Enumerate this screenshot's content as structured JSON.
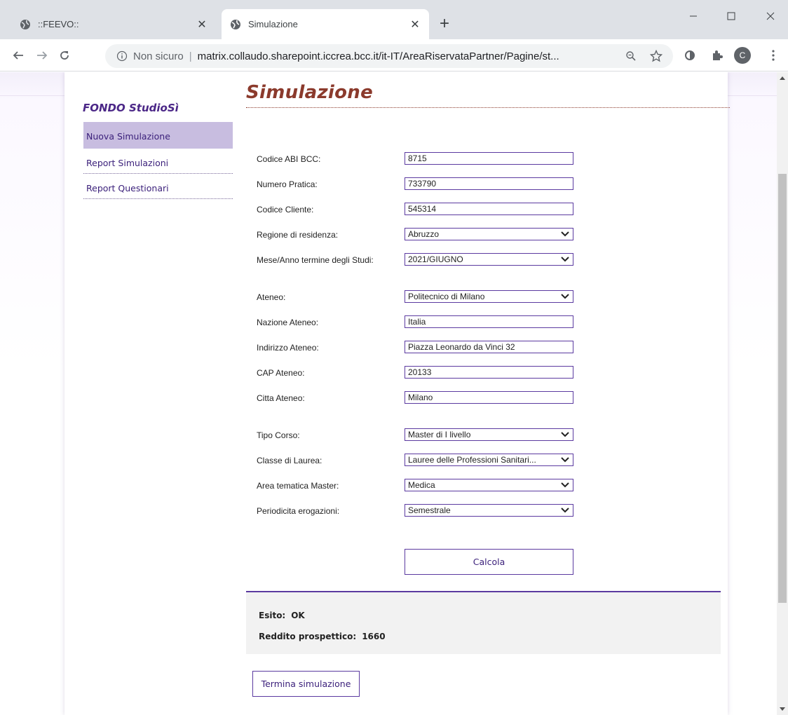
{
  "browser": {
    "tabs": [
      {
        "title": "::FEEVO::",
        "icon": "globe-icon",
        "active": false
      },
      {
        "title": "Simulazione",
        "icon": "globe-icon",
        "active": true
      }
    ],
    "new_tab": "+",
    "window_controls": {
      "minimize": "–",
      "maximize": "☐",
      "close": "✕"
    },
    "address_bar": {
      "security_label": "Non sicuro",
      "separator": "|",
      "url": "matrix.collaudo.sharepoint.iccrea.bcc.it/it-IT/AreaRiservataPartner/Pagine/st..."
    },
    "profile_initial": "C"
  },
  "sidebar": {
    "title": "FONDO StudioSì",
    "items": [
      {
        "label": "Nuova Simulazione",
        "active": true
      },
      {
        "label": "Report Simulazioni",
        "active": false
      },
      {
        "label": "Report Questionari",
        "active": false
      }
    ]
  },
  "main": {
    "title": "Simulazione",
    "fields": {
      "codice_abi": {
        "label": "Codice ABI BCC:",
        "value": "8715"
      },
      "numero_pratica": {
        "label": "Numero Pratica:",
        "value": "733790"
      },
      "codice_cliente": {
        "label": "Codice Cliente:",
        "value": "545314"
      },
      "regione": {
        "label": "Regione di residenza:",
        "value": "Abruzzo"
      },
      "mese_anno": {
        "label": "Mese/Anno termine degli Studi:",
        "value": "2021/GIUGNO"
      },
      "ateneo": {
        "label": "Ateneo:",
        "value": "Politecnico di Milano"
      },
      "nazione_ateneo": {
        "label": "Nazione Ateneo:",
        "value": "Italia"
      },
      "indirizzo_ateneo": {
        "label": "Indirizzo Ateneo:",
        "value": "Piazza Leonardo da Vinci 32"
      },
      "cap_ateneo": {
        "label": "CAP Ateneo:",
        "value": "20133"
      },
      "citta_ateneo": {
        "label": "Citta Ateneo:",
        "value": "Milano"
      },
      "tipo_corso": {
        "label": "Tipo Corso:",
        "value": "Master di I livello"
      },
      "classe_laurea": {
        "label": "Classe di Laurea:",
        "value": "Lauree delle Professioni Sanitari..."
      },
      "area_tematica": {
        "label": "Area tematica Master:",
        "value": "Medica"
      },
      "periodicita": {
        "label": "Periodicita erogazioni:",
        "value": "Semestrale"
      }
    },
    "calcola_label": "Calcola",
    "result": {
      "esito_label": "Esito:",
      "esito_value": "OK",
      "reddito_label": "Reddito prospettico:",
      "reddito_value": "1660"
    },
    "termina_label": "Termina simulazione"
  }
}
